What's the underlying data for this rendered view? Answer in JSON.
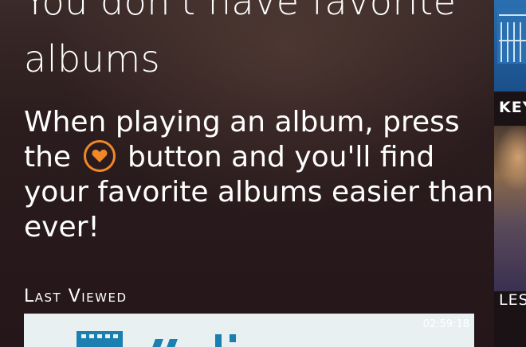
{
  "empty_state": {
    "heading_line1": "You don't have favorite",
    "heading_line2": "albums",
    "body_line1": "When playing an album, press",
    "body_line2_before": "the",
    "body_line2_after": "button and you'll find",
    "body_line3": "your favorite albums easier than",
    "body_line4": "ever!"
  },
  "section": {
    "title": "Last Viewed"
  },
  "last_viewed": {
    "duration": "02:59:18"
  },
  "side_tiles": [
    {
      "label": "KEY"
    },
    {
      "label": "LES"
    }
  ],
  "colors": {
    "accent": "#f0882a",
    "background": "#2a1a1c",
    "text": "#ffffff"
  },
  "icons": {
    "favorite": "heart-icon"
  }
}
